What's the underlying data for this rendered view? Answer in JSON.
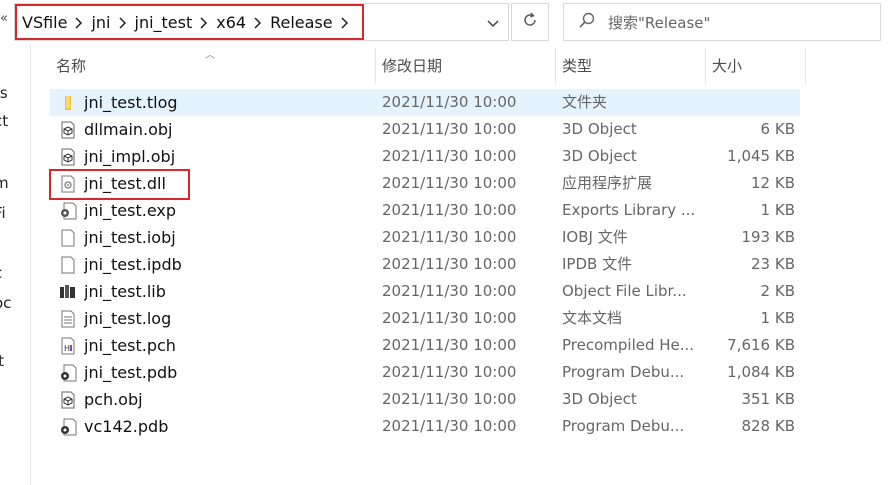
{
  "breadcrumb": {
    "overflow": "«",
    "items": [
      "VSfile",
      "jni",
      "jni_test",
      "x64",
      "Release"
    ]
  },
  "search": {
    "placeholder": "搜索\"Release\""
  },
  "columns": {
    "name": "名称",
    "date": "修改日期",
    "type": "类型",
    "size": "大小"
  },
  "left_pane_fragments": [
    "ts",
    "ct",
    "m",
    "Fi",
    "c",
    "oc",
    "it"
  ],
  "files": [
    {
      "name": "jni_test.tlog",
      "date": "2021/11/30 10:00",
      "type": "文件夹",
      "size": "",
      "icon": "folder-icon",
      "selected": true
    },
    {
      "name": "dllmain.obj",
      "date": "2021/11/30 10:00",
      "type": "3D Object",
      "size": "6 KB",
      "icon": "3d-object-icon"
    },
    {
      "name": "jni_impl.obj",
      "date": "2021/11/30 10:00",
      "type": "3D Object",
      "size": "1,045 KB",
      "icon": "3d-object-icon"
    },
    {
      "name": "jni_test.dll",
      "date": "2021/11/30 10:00",
      "type": "应用程序扩展",
      "size": "12 KB",
      "icon": "dll-icon"
    },
    {
      "name": "jni_test.exp",
      "date": "2021/11/30 10:00",
      "type": "Exports Library ...",
      "size": "1 KB",
      "icon": "gear-file-icon"
    },
    {
      "name": "jni_test.iobj",
      "date": "2021/11/30 10:00",
      "type": "IOBJ 文件",
      "size": "193 KB",
      "icon": "blank-file-icon"
    },
    {
      "name": "jni_test.ipdb",
      "date": "2021/11/30 10:00",
      "type": "IPDB 文件",
      "size": "23 KB",
      "icon": "blank-file-icon"
    },
    {
      "name": "jni_test.lib",
      "date": "2021/11/30 10:00",
      "type": "Object File Libr...",
      "size": "2 KB",
      "icon": "library-icon"
    },
    {
      "name": "jni_test.log",
      "date": "2021/11/30 10:00",
      "type": "文本文档",
      "size": "1 KB",
      "icon": "text-file-icon"
    },
    {
      "name": "jni_test.pch",
      "date": "2021/11/30 10:00",
      "type": "Precompiled He...",
      "size": "7,616 KB",
      "icon": "header-file-icon"
    },
    {
      "name": "jni_test.pdb",
      "date": "2021/11/30 10:00",
      "type": "Program Debu...",
      "size": "1,084 KB",
      "icon": "pdb-file-icon"
    },
    {
      "name": "pch.obj",
      "date": "2021/11/30 10:00",
      "type": "3D Object",
      "size": "351 KB",
      "icon": "3d-object-icon"
    },
    {
      "name": "vc142.pdb",
      "date": "2021/11/30 10:00",
      "type": "Program Debu...",
      "size": "828 KB",
      "icon": "pdb-file-icon"
    }
  ]
}
